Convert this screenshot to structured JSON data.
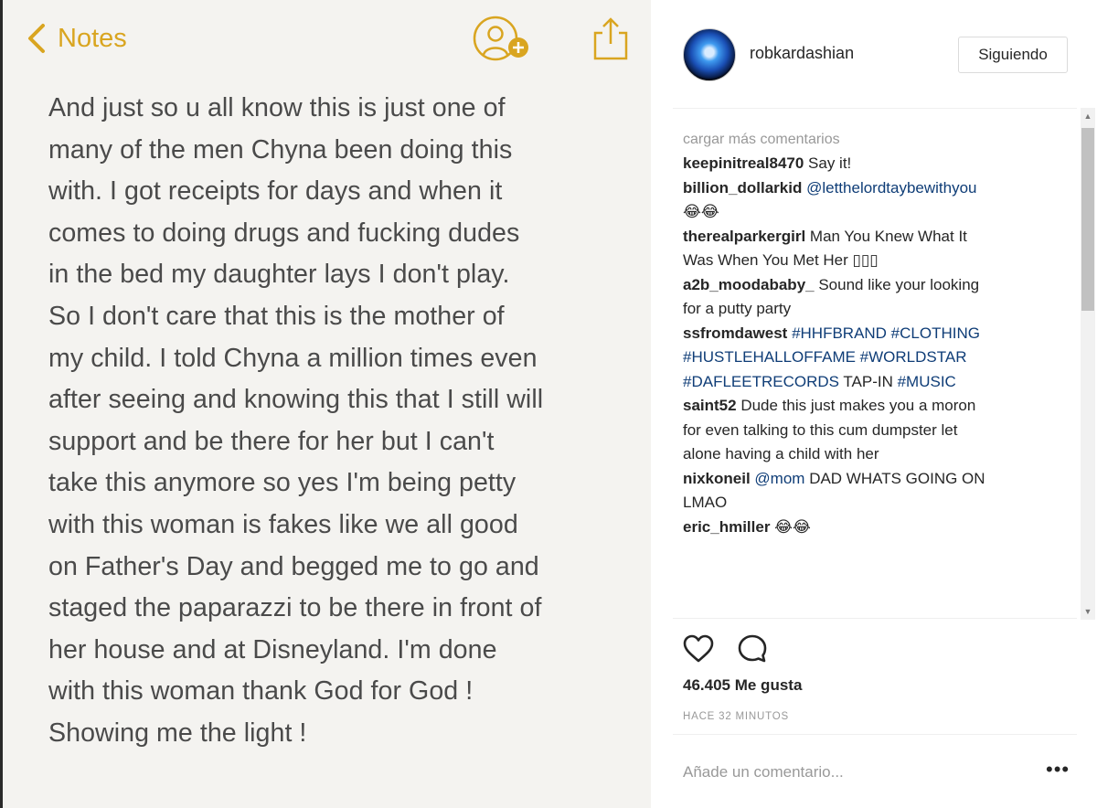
{
  "notes": {
    "back_label": "Notes",
    "lines": [
      "And just so u all know this is just one of",
      "many of the men Chyna been doing this",
      "with. I got receipts for days and when it",
      "comes to doing drugs and fucking dudes",
      "in the bed my daughter lays I don't play.",
      "So I don't care that this is the mother of",
      "my child. I told Chyna a million times even",
      "after seeing and knowing this that I still will",
      "support and be there for her but I can't",
      "take this anymore so yes I'm being petty",
      "with this woman is fakes like we all good",
      "on Father's Day and begged me to go and",
      "staged the paparazzi to be there in front of",
      "her house and at Disneyland. I'm done",
      "with this woman thank God for God !",
      "Showing me the light !"
    ],
    "accent_color": "#d9a520",
    "icons": {
      "back": "chevron-left-icon",
      "add_person": "add-person-icon",
      "share": "share-icon"
    }
  },
  "post": {
    "username": "robkardashian",
    "follow_label": "Siguiendo",
    "load_more": "cargar más comentarios",
    "comments": [
      {
        "user": "keepinitreal8470",
        "lines": [
          [
            {
              "t": " Say it!"
            }
          ]
        ]
      },
      {
        "user": "billion_dollarkid",
        "lines": [
          [
            {
              "t": " "
            },
            {
              "t": "@letthelordtaybewithyou",
              "tag": true
            }
          ],
          [
            {
              "t": "😂😂"
            }
          ]
        ]
      },
      {
        "user": "therealparkergirl",
        "lines": [
          [
            {
              "t": " Man You Knew What It"
            }
          ],
          [
            {
              "t": "Was When You Met Her ▯▯▯"
            }
          ]
        ]
      },
      {
        "user": "a2b_moodababy_",
        "lines": [
          [
            {
              "t": " Sound like your looking"
            }
          ],
          [
            {
              "t": "for a putty party"
            }
          ]
        ]
      },
      {
        "user": "ssfromdawest",
        "lines": [
          [
            {
              "t": " "
            },
            {
              "t": "#HHFBRAND #CLOTHING",
              "tag": true
            }
          ],
          [
            {
              "t": "#HUSTLEHALLOFFAME #WORLDSTAR",
              "tag": true
            }
          ],
          [
            {
              "t": "#DAFLEETRECORDS",
              "tag": true
            },
            {
              "t": " TAP-IN "
            },
            {
              "t": "#MUSIC",
              "tag": true
            }
          ]
        ]
      },
      {
        "user": "saint52",
        "lines": [
          [
            {
              "t": " Dude this just makes you a moron"
            }
          ],
          [
            {
              "t": "for even talking to this cum dumpster let"
            }
          ],
          [
            {
              "t": "alone having a child with her"
            }
          ]
        ]
      },
      {
        "user": "nixkoneil",
        "lines": [
          [
            {
              "t": " "
            },
            {
              "t": "@mom",
              "tag": true
            },
            {
              "t": " DAD WHATS GOING ON"
            }
          ],
          [
            {
              "t": "LMAO"
            }
          ]
        ]
      },
      {
        "user": "eric_hmiller",
        "lines": [
          [
            {
              "t": " 😂😂"
            }
          ]
        ]
      }
    ],
    "likes": "46.405 Me gusta",
    "time": "HACE 32 MINUTOS",
    "comment_placeholder": "Añade un comentario...",
    "more_label": "•••",
    "icons": {
      "like": "heart-icon",
      "comment": "comment-icon",
      "more": "more-icon"
    },
    "tag_color": "#0f3d77"
  }
}
